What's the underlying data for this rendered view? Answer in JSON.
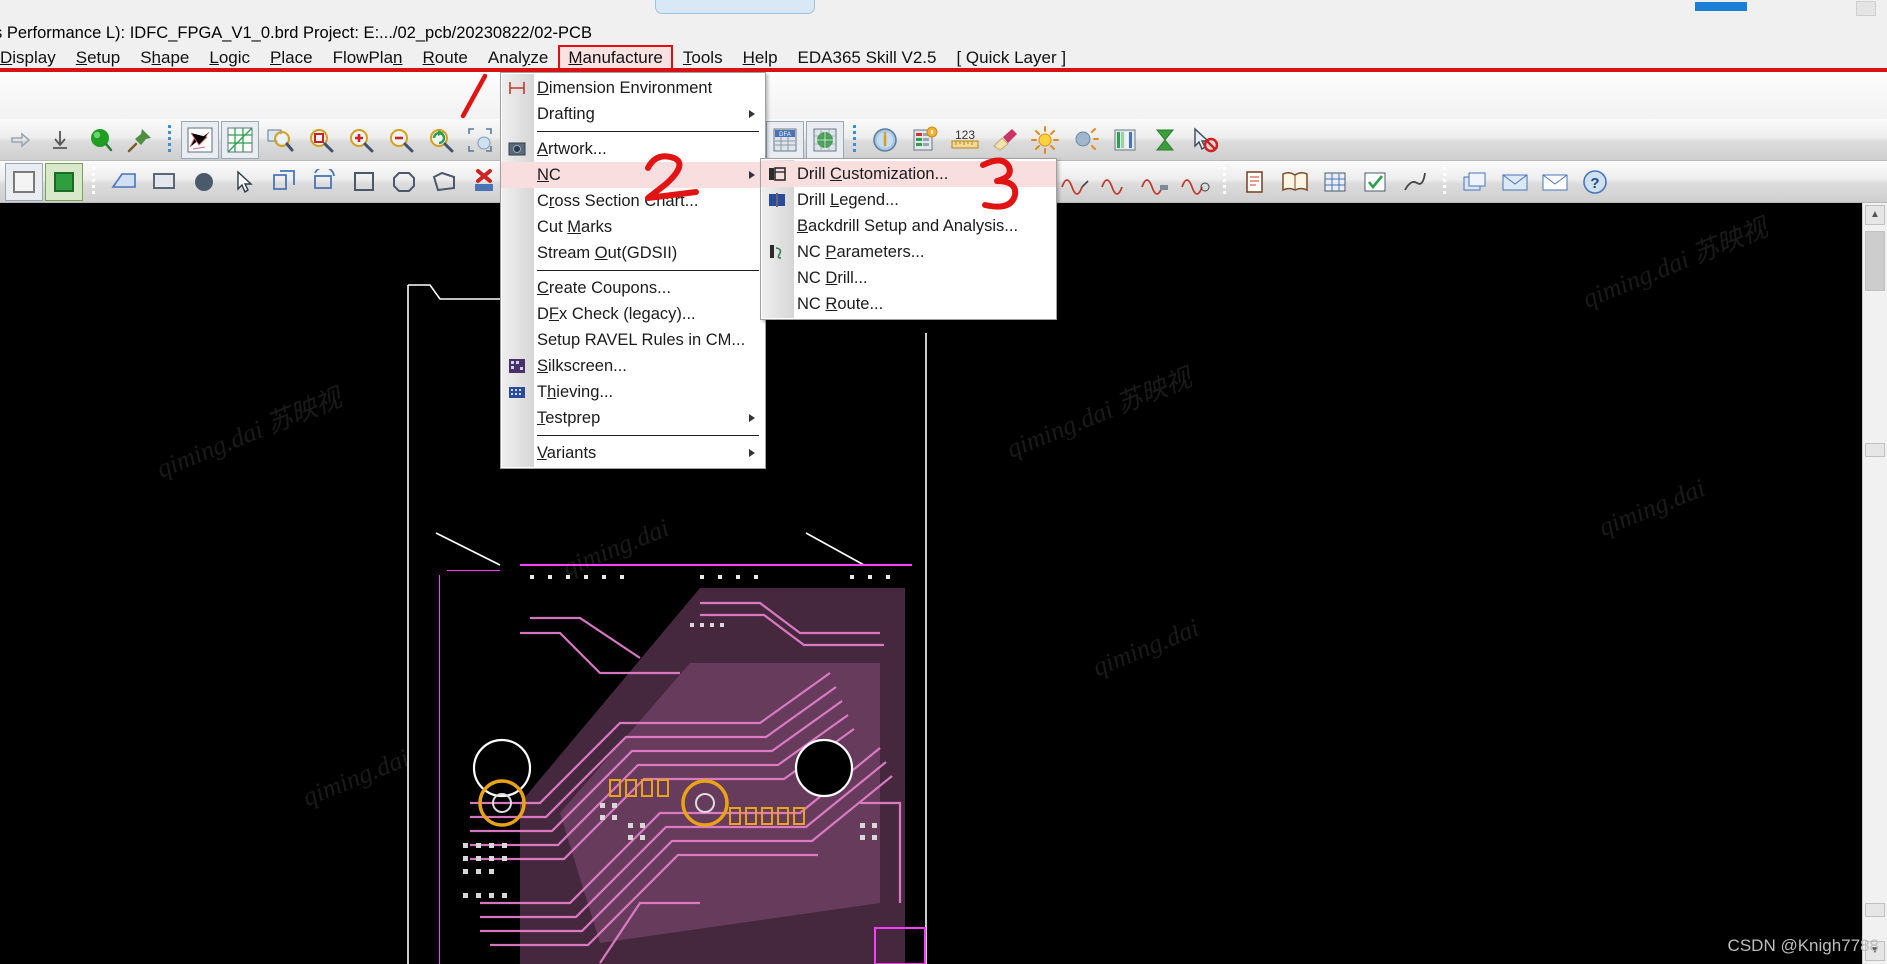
{
  "window": {
    "doc_line": "s Performance L): IDFC_FPGA_V1_0.brd  Project: E:.../02_pcb/20230822/02-PCB"
  },
  "menubar": {
    "items": [
      {
        "label": "Display",
        "underline": "D",
        "active": false
      },
      {
        "label": "Setup",
        "underline": "S",
        "active": false
      },
      {
        "label": "Shape",
        "underline": "h",
        "active": false
      },
      {
        "label": "Logic",
        "underline": "L",
        "active": false
      },
      {
        "label": "Place",
        "underline": "P",
        "active": false
      },
      {
        "label": "FlowPlan",
        "underline": "n",
        "active": false
      },
      {
        "label": "Route",
        "underline": "R",
        "active": false
      },
      {
        "label": "Analyze",
        "underline": "y",
        "active": false
      },
      {
        "label": "Manufacture",
        "underline": "M",
        "active": true
      },
      {
        "label": "Tools",
        "underline": "T",
        "active": false
      },
      {
        "label": "Help",
        "underline": "H",
        "active": false
      }
    ],
    "extra": [
      "EDA365 Skill V2.5",
      "[ Quick Layer ]"
    ]
  },
  "manufacture_menu": {
    "items": [
      {
        "label": "Dimension Environment",
        "icon": "dimension-icon",
        "submenu": false,
        "highlight": false,
        "underline": "D"
      },
      {
        "label": "Drafting",
        "icon": "",
        "submenu": true,
        "highlight": false,
        "underline": "g"
      },
      {
        "separator": true
      },
      {
        "label": "Artwork...",
        "icon": "artwork-icon",
        "submenu": false,
        "highlight": false,
        "underline": "A"
      },
      {
        "label": "NC",
        "icon": "",
        "submenu": true,
        "highlight": true,
        "underline": "N"
      },
      {
        "label": "Cross Section Chart...",
        "icon": "",
        "submenu": false,
        "highlight": false,
        "underline": "r"
      },
      {
        "label": "Cut Marks",
        "icon": "",
        "submenu": false,
        "highlight": false,
        "underline": "M"
      },
      {
        "label": "Stream Out(GDSII)",
        "icon": "",
        "submenu": false,
        "highlight": false,
        "underline": "O"
      },
      {
        "separator": true
      },
      {
        "label": "Create Coupons...",
        "icon": "",
        "submenu": false,
        "highlight": false,
        "underline": "C"
      },
      {
        "label": "DFx Check (legacy)...",
        "icon": "",
        "submenu": false,
        "highlight": false,
        "underline": "F"
      },
      {
        "label": "Setup RAVEL Rules in CM...",
        "icon": "",
        "submenu": false,
        "highlight": false,
        "underline": ""
      },
      {
        "label": "Silkscreen...",
        "icon": "silkscreen-icon",
        "submenu": false,
        "highlight": false,
        "underline": "S"
      },
      {
        "label": "Thieving...",
        "icon": "thieving-icon",
        "submenu": false,
        "highlight": false,
        "underline": "h"
      },
      {
        "label": "Testprep",
        "icon": "",
        "submenu": true,
        "highlight": false,
        "underline": "T"
      },
      {
        "separator": true
      },
      {
        "label": "Variants",
        "icon": "",
        "submenu": true,
        "highlight": false,
        "underline": "V"
      }
    ]
  },
  "nc_submenu": {
    "items": [
      {
        "label": "Drill Customization...",
        "icon": "drill-customization-icon",
        "highlight": true,
        "underline": "C"
      },
      {
        "label": "Drill Legend...",
        "icon": "drill-legend-icon",
        "highlight": false,
        "underline": "L"
      },
      {
        "label": "Backdrill Setup and Analysis...",
        "icon": "",
        "highlight": false,
        "underline": "B"
      },
      {
        "label": "NC Parameters...",
        "icon": "nc-parameters-icon",
        "highlight": false,
        "underline": "P"
      },
      {
        "label": "NC Drill...",
        "icon": "",
        "highlight": false,
        "underline": "D"
      },
      {
        "label": "NC Route...",
        "icon": "",
        "highlight": false,
        "underline": "R"
      }
    ]
  },
  "annotations": [
    {
      "name": "step-1",
      "label": "1"
    },
    {
      "name": "step-2",
      "label": "2"
    },
    {
      "name": "step-3",
      "label": "3"
    }
  ],
  "toolbars": {
    "row2": [
      "arrow-right-icon",
      "download-icon",
      "green-sphere-icon",
      "pin-icon",
      "sep",
      "ratsnest-icon",
      "grid-icon",
      "zoom-fit-icon",
      "zoom-area-icon",
      "zoom-in-icon",
      "zoom-out-icon",
      "zoom-refresh-icon",
      "zoom-select-icon",
      "undo-icon",
      "3d-icon"
    ],
    "row2b": [
      "dfa-table-icon",
      "world-grid-icon",
      "sep",
      "info-icon",
      "report-icon",
      "measure-123-icon",
      "highlight-icon",
      "sun-icon",
      "shade-icon",
      "color-bars-icon",
      "hourglass-icon",
      "cursor-block-icon"
    ],
    "row3": [
      "rect-icon",
      "shape-green-icon",
      "sep",
      "zone-icon",
      "rect2-icon",
      "circle-icon",
      "cursor-icon",
      "copy-shape-icon",
      "rotate-icon",
      "square-icon",
      "octagon-icon",
      "polygon-icon",
      "delete-icon",
      "sep"
    ],
    "row3b": [
      "waveform1-icon",
      "waveform2-icon",
      "waveform3-icon",
      "waveform4-icon",
      "sep",
      "doc-icon",
      "book-icon",
      "table-icon",
      "check-icon",
      "pen-icon",
      "sep",
      "layers-icon",
      "mail-icon",
      "envelope-icon",
      "help-icon"
    ]
  },
  "watermarks": {
    "texts": [
      "qiming.dai  苏映视",
      "qiming.dai 苏映视",
      "qiming.dai"
    ],
    "credit": "CSDN @Knigh7788"
  },
  "colors": {
    "accent_red": "#d81212",
    "menu_highlight": "#f8dede",
    "pcb_trace": "#e27ac8",
    "pcb_outline": "#ffffff",
    "pcb_magenta": "#ff00ff",
    "pcb_gold": "#e8a317"
  }
}
